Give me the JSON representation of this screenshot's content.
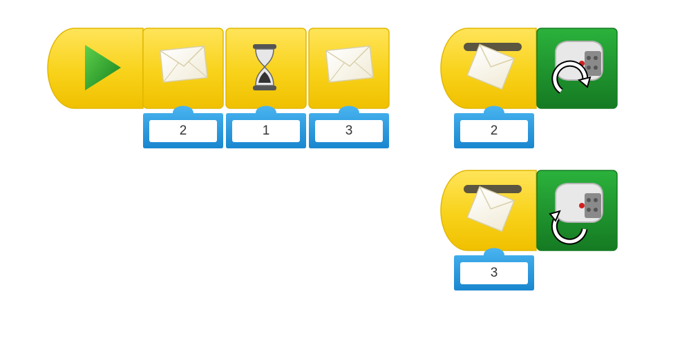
{
  "program_left": {
    "start": {
      "icon": "play-icon"
    },
    "blocks": [
      {
        "type": "send-message",
        "icon": "envelope-icon",
        "value": "2"
      },
      {
        "type": "wait",
        "icon": "hourglass-icon",
        "value": "1"
      },
      {
        "type": "send-message",
        "icon": "envelope-icon",
        "value": "3"
      }
    ]
  },
  "program_right_top": {
    "start": {
      "icon": "receive-message-icon",
      "value": "2"
    },
    "motor": {
      "icon": "motor-clockwise-icon"
    }
  },
  "program_right_bottom": {
    "start": {
      "icon": "receive-message-icon",
      "value": "3"
    },
    "motor": {
      "icon": "motor-counterclockwise-icon"
    }
  },
  "colors": {
    "block_yellow": "#f6cf1a",
    "block_yellow_dark": "#e0b400",
    "motor_green": "#1f9a2e",
    "param_blue": "#2a9be0",
    "play_green": "#2fa73a"
  }
}
